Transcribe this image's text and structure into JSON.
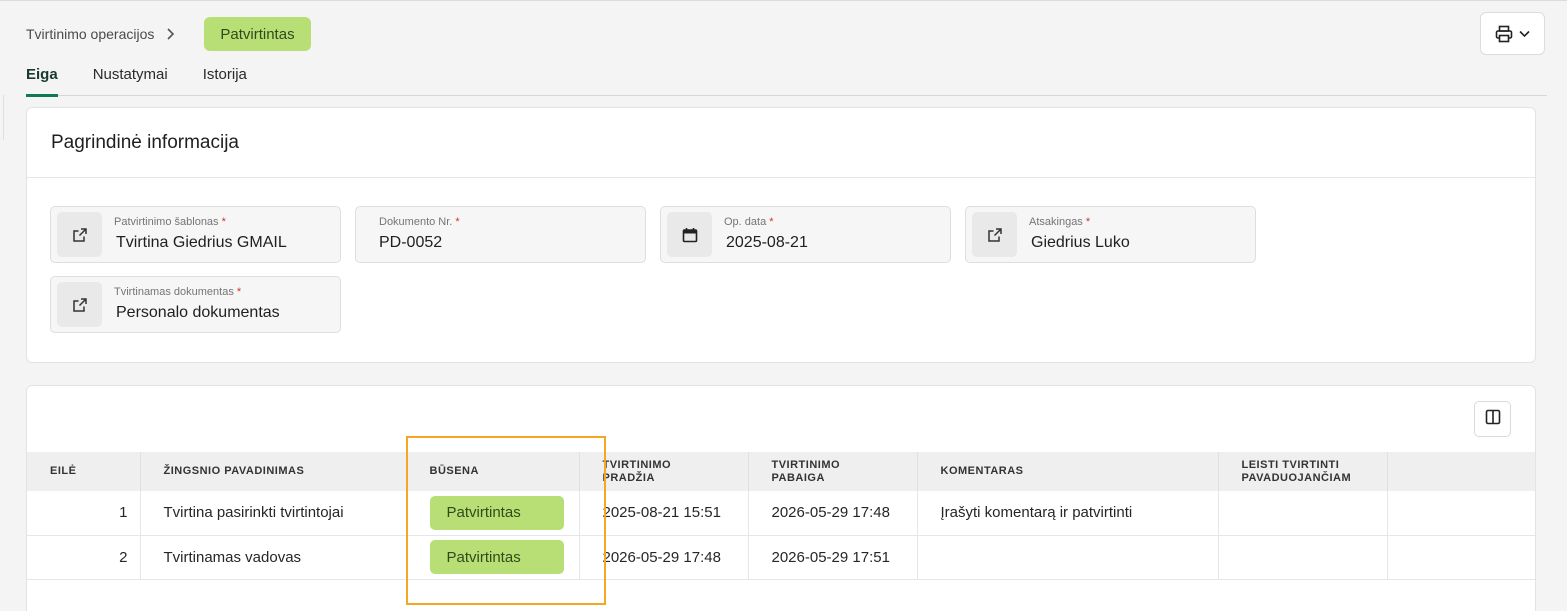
{
  "breadcrumb": {
    "parent": "Tvirtinimo operacijos",
    "current_status": "Patvirtintas"
  },
  "toolbar": {
    "print_icon": "printer-icon",
    "dropdown_icon": "chevron-down-icon"
  },
  "tabs": [
    {
      "label": "Eiga",
      "active": true
    },
    {
      "label": "Nustatymai",
      "active": false
    },
    {
      "label": "Istorija",
      "active": false
    }
  ],
  "info": {
    "title": "Pagrindinė informacija",
    "fields": {
      "template": {
        "label": "Patvirtinimo šablonas",
        "required": "*",
        "value": "Tvirtina Giedrius GMAIL",
        "icon": "external-link-icon"
      },
      "doc_no": {
        "label": "Dokumento Nr.",
        "required": "*",
        "value": "PD-0052"
      },
      "op_date": {
        "label": "Op. data",
        "required": "*",
        "value": "2025-08-21",
        "icon": "calendar-icon"
      },
      "responsible": {
        "label": "Atsakingas",
        "required": "*",
        "value": "Giedrius Luko",
        "icon": "external-link-icon"
      },
      "document": {
        "label": "Tvirtinamas dokumentas",
        "required": "*",
        "value": "Personalo dokumentas",
        "icon": "external-link-icon"
      }
    }
  },
  "table": {
    "columns_icon": "columns-icon",
    "headers": {
      "order": "EILĖ",
      "step_name": "ŽINGSNIO PAVADINIMAS",
      "status": "BŪSENA",
      "start_1": "TVIRTINIMO",
      "start_2": "PRADŽIA",
      "end_1": "TVIRTINIMO",
      "end_2": "PABAIGA",
      "comment": "KOMENTARAS",
      "deputy_1": "LEISTI TVIRTINTI",
      "deputy_2": "PAVADUOJANČIAM"
    },
    "rows": [
      {
        "order": "1",
        "step_name": "Tvirtina pasirinkti tvirtintojai",
        "status": "Patvirtintas",
        "start": "2025-08-21 15:51",
        "end": "2026-05-29 17:48",
        "comment": "Įrašyti komentarą ir patvirtinti",
        "deputy": ""
      },
      {
        "order": "2",
        "step_name": "Tvirtinamas vadovas",
        "status": "Patvirtintas",
        "start": "2026-05-29 17:48",
        "end": "2026-05-29 17:51",
        "comment": "",
        "deputy": ""
      }
    ]
  },
  "colors": {
    "accent": "#0f7a52",
    "status_green": "#b8df75",
    "highlight": "#f5a623"
  }
}
